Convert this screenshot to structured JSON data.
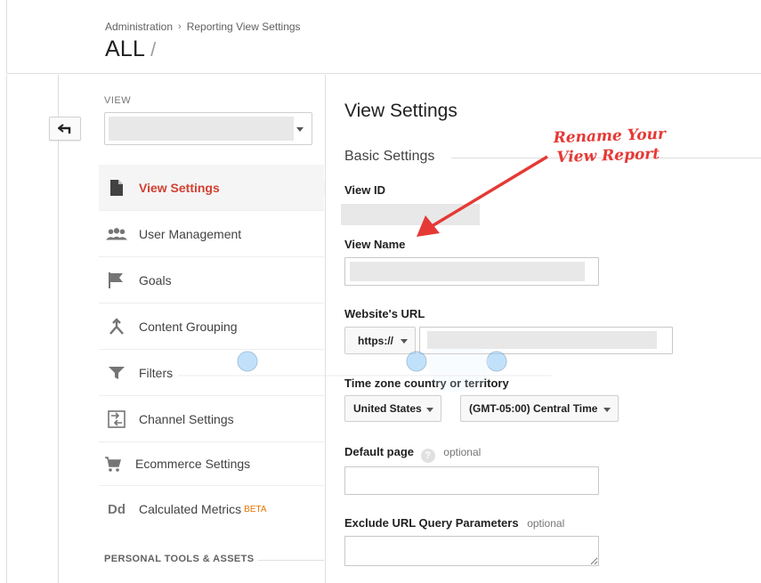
{
  "header": {
    "breadcrumb": [
      "Administration",
      "Reporting View Settings"
    ],
    "breadcrumb_sep": "›",
    "title": "ALL",
    "title_suffix": "/"
  },
  "sidebar": {
    "view_label": "VIEW",
    "view_select_value": "",
    "items": [
      {
        "label": "View Settings",
        "icon": "document-icon",
        "active": true
      },
      {
        "label": "User Management",
        "icon": "users-icon"
      },
      {
        "label": "Goals",
        "icon": "flag-icon"
      },
      {
        "label": "Content Grouping",
        "icon": "content-grouping-icon"
      },
      {
        "label": "Filters",
        "icon": "filter-icon"
      },
      {
        "label": "Channel Settings",
        "icon": "channel-settings-icon"
      },
      {
        "label": "Ecommerce Settings",
        "icon": "cart-icon"
      },
      {
        "label": "Calculated Metrics",
        "icon": "calculated-metrics-icon",
        "badge": "BETA"
      }
    ],
    "section_personal": "PERSONAL TOOLS & ASSETS"
  },
  "main": {
    "title": "View Settings",
    "section": "Basic Settings",
    "view_id_label": "View ID",
    "view_name_label": "View Name",
    "website_url_label": "Website's URL",
    "protocol_value": "https://",
    "timezone_label": "Time zone country or territory",
    "country_value": "United States",
    "timezone_value": "(GMT-05:00) Central Time",
    "default_page_label": "Default page",
    "optional_text": "optional",
    "help_glyph": "?",
    "exclude_params_label": "Exclude URL Query Parameters"
  },
  "annotation": {
    "line1": "Rename Your",
    "line2": "View Report",
    "color": "#e53935"
  },
  "colors": {
    "active_red": "#d23f31",
    "beta_orange": "#e37400"
  }
}
